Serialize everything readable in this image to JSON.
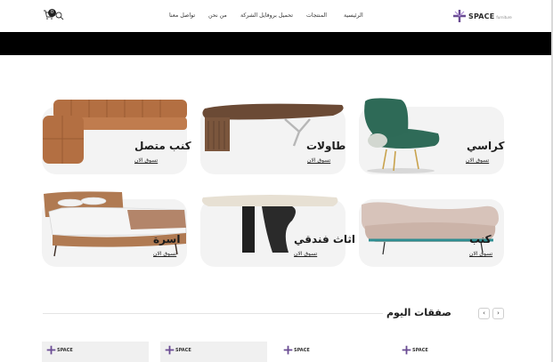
{
  "header": {
    "logo_text": "SPACE",
    "logo_sub": "furniture",
    "nav": [
      "الرئيسية",
      "المنتجات",
      "تحميل بروفايل الشركة",
      "من نحن",
      "تواصل معنا"
    ],
    "cart_count": "0",
    "icons": [
      "cart-icon",
      "search-icon"
    ]
  },
  "categories": [
    {
      "title": "كراسي",
      "link": "تسوق الان"
    },
    {
      "title": "طاولات",
      "link": "تسوق الان"
    },
    {
      "title": "كنب متصل",
      "link": "تسوق الان"
    },
    {
      "title": "كنب",
      "link": "تسوق الان"
    },
    {
      "title": "اثاث فندقي",
      "link": "تسوق الان"
    },
    {
      "title": "اسرة",
      "link": "تسوق الان"
    }
  ],
  "deals": {
    "title": "صفقات اليوم",
    "prev": "‹",
    "next": "›"
  },
  "colors": {
    "brand_purple": "#6a4c93",
    "banner": "#000000",
    "card_bg": "#f3f3f3"
  }
}
